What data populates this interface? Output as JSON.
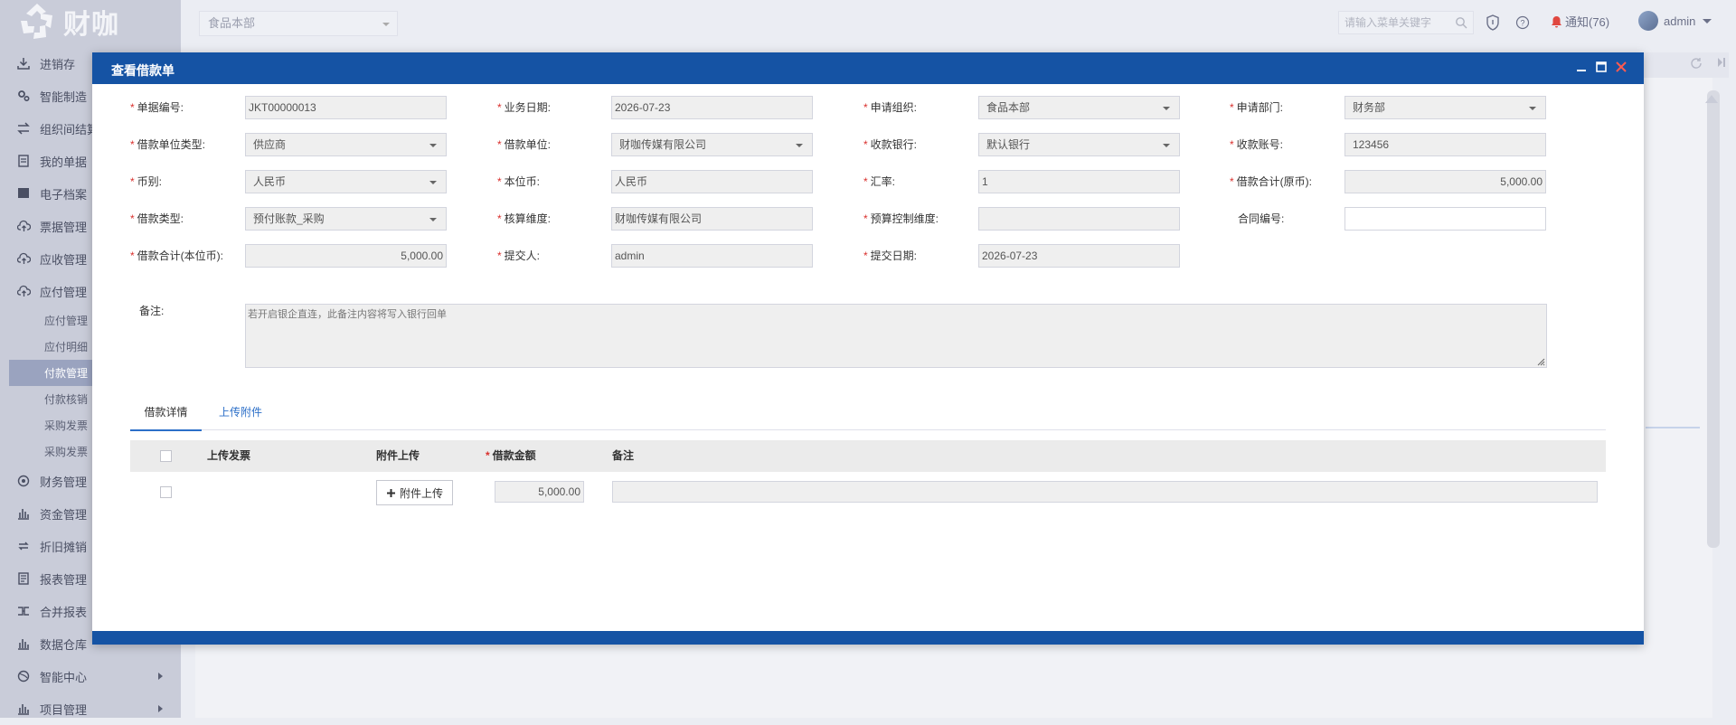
{
  "app": {
    "logo_text": "财咖",
    "org_selected": "食品本部"
  },
  "topbar": {
    "search_placeholder": "请输入菜单关键字",
    "notice_label": "通知(76)",
    "user_name": "admin"
  },
  "sidebar": {
    "items": [
      {
        "label": "进销存",
        "icon": "download-icon"
      },
      {
        "label": "智能制造",
        "icon": "gears-icon"
      },
      {
        "label": "组织间结算",
        "icon": "transfer-icon"
      },
      {
        "label": "我的单据",
        "icon": "document-icon"
      },
      {
        "label": "电子档案",
        "icon": "archive-icon"
      },
      {
        "label": "票据管理",
        "icon": "cloud-upload-icon"
      },
      {
        "label": "应收管理",
        "icon": "cloud-upload-icon"
      },
      {
        "label": "应付管理",
        "icon": "cloud-upload-icon"
      }
    ],
    "sub_items": [
      {
        "label": "应付管理"
      },
      {
        "label": "应付明细"
      },
      {
        "label": "付款管理"
      },
      {
        "label": "付款核销"
      },
      {
        "label": "采购发票"
      },
      {
        "label": "采购发票"
      }
    ],
    "items_after": [
      {
        "label": "财务管理",
        "icon": "finance-icon"
      },
      {
        "label": "资金管理",
        "icon": "bar-chart-icon"
      },
      {
        "label": "折旧摊销",
        "icon": "cycle-icon"
      },
      {
        "label": "报表管理",
        "icon": "report-icon"
      },
      {
        "label": "合并报表",
        "icon": "merge-icon"
      },
      {
        "label": "数据仓库",
        "icon": "bar-chart-icon"
      },
      {
        "label": "智能中心",
        "icon": "globe-icon"
      },
      {
        "label": "项目管理",
        "icon": "bar-chart-icon"
      }
    ]
  },
  "dialog": {
    "title": "查看借款单",
    "fields": {
      "doc_no": {
        "label": "单据编号:",
        "value": "JKT00000013"
      },
      "biz_date": {
        "label": "业务日期:",
        "value": "2026-07-23"
      },
      "apply_org": {
        "label": "申请组织:",
        "value": "食品本部"
      },
      "apply_dept": {
        "label": "申请部门:",
        "value": "财务部"
      },
      "borrower_type": {
        "label": "借款单位类型:",
        "value": "供应商"
      },
      "borrower": {
        "label": "借款单位:",
        "value": "财咖传媒有限公司"
      },
      "bank": {
        "label": "收款银行:",
        "value": "默认银行"
      },
      "account": {
        "label": "收款账号:",
        "value": "123456"
      },
      "currency": {
        "label": "币别:",
        "value": "人民币"
      },
      "base_currency": {
        "label": "本位币:",
        "value": "人民币"
      },
      "rate": {
        "label": "汇率:",
        "value": "1"
      },
      "total_orig": {
        "label": "借款合计(原币):",
        "value": "5,000.00"
      },
      "loan_type": {
        "label": "借款类型:",
        "value": "预付账款_采购"
      },
      "acc_dim": {
        "label": "核算维度:",
        "value": "财咖传媒有限公司"
      },
      "budget_dim": {
        "label": "预算控制维度:",
        "value": ""
      },
      "contract_no": {
        "label": "合同编号:",
        "value": ""
      },
      "total_base": {
        "label": "借款合计(本位币):",
        "value": "5,000.00"
      },
      "submitter": {
        "label": "提交人:",
        "value": "admin"
      },
      "submit_date": {
        "label": "提交日期:",
        "value": "2026-07-23"
      },
      "remark": {
        "label": "备注:",
        "value": "若开启银企直连，此备注内容将写入银行回单"
      }
    },
    "tabs": [
      {
        "label": "借款详情"
      },
      {
        "label": "上传附件"
      }
    ],
    "grid": {
      "columns": {
        "invoice": "上传发票",
        "attachment": "附件上传",
        "amount": "借款金额",
        "note": "备注"
      },
      "row": {
        "upload_button": "附件上传",
        "amount": "5,000.00",
        "note": ""
      }
    }
  },
  "colors": {
    "header_blue": "#1553a4",
    "required_red": "#d9302d",
    "link_blue": "#2c6fc8"
  }
}
